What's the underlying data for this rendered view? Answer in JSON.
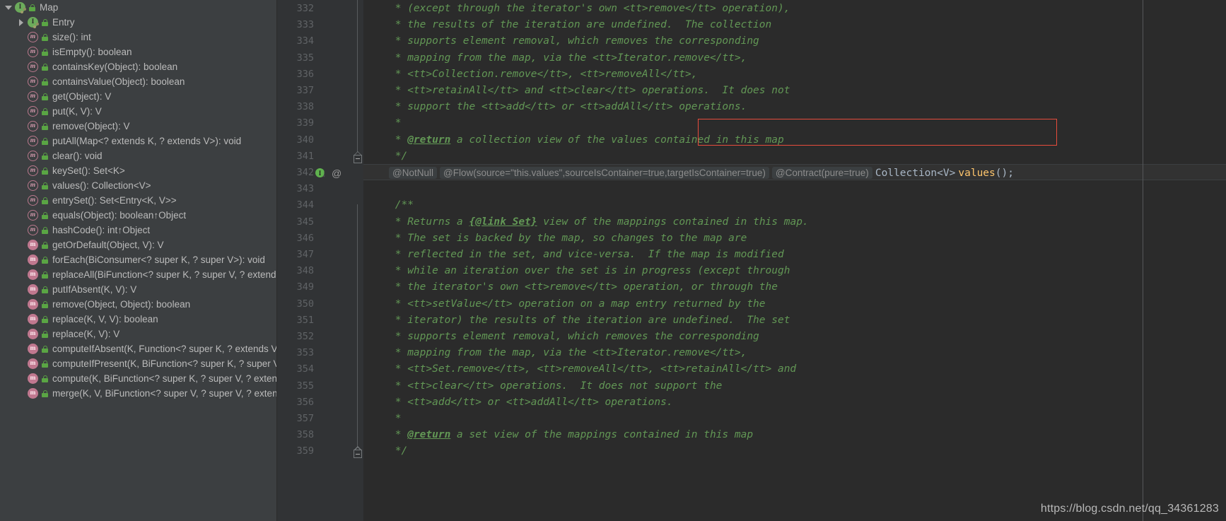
{
  "theme": {
    "panel_bg": "#3c3f41",
    "editor_bg": "#2b2b2b",
    "gutter_bg": "#313335",
    "javadoc_green": "#629755",
    "inlay_grey": "#8c8c8c",
    "method_yellow": "#ffc66d",
    "highlight_red": "#e74c3c",
    "tree_text": "#bbbbbb",
    "line_number": "#606366"
  },
  "structure_panel": {
    "name": "structure-tool-window",
    "items": [
      {
        "label": "Map",
        "indent": 0,
        "twisty": "expanded",
        "icon": "interface-icon",
        "icon_glyph": "I",
        "lock": "public-lock-icon",
        "inherited": ""
      },
      {
        "label": "Entry",
        "indent": 1,
        "twisty": "collapsed",
        "icon": "interface-icon",
        "icon_glyph": "I",
        "lock": "public-lock-icon",
        "inherited": ""
      },
      {
        "label": "size(): int",
        "indent": 1,
        "twisty": "none",
        "icon": "abstract-method-icon",
        "icon_glyph": "m",
        "lock": "public-lock-icon",
        "inherited": ""
      },
      {
        "label": "isEmpty(): boolean",
        "indent": 1,
        "twisty": "none",
        "icon": "abstract-method-icon",
        "icon_glyph": "m",
        "lock": "public-lock-icon",
        "inherited": ""
      },
      {
        "label": "containsKey(Object): boolean",
        "indent": 1,
        "twisty": "none",
        "icon": "abstract-method-icon",
        "icon_glyph": "m",
        "lock": "public-lock-icon",
        "inherited": ""
      },
      {
        "label": "containsValue(Object): boolean",
        "indent": 1,
        "twisty": "none",
        "icon": "abstract-method-icon",
        "icon_glyph": "m",
        "lock": "public-lock-icon",
        "inherited": ""
      },
      {
        "label": "get(Object): V",
        "indent": 1,
        "twisty": "none",
        "icon": "abstract-method-icon",
        "icon_glyph": "m",
        "lock": "public-lock-icon",
        "inherited": ""
      },
      {
        "label": "put(K, V): V",
        "indent": 1,
        "twisty": "none",
        "icon": "abstract-method-icon",
        "icon_glyph": "m",
        "lock": "public-lock-icon",
        "inherited": ""
      },
      {
        "label": "remove(Object): V",
        "indent": 1,
        "twisty": "none",
        "icon": "abstract-method-icon",
        "icon_glyph": "m",
        "lock": "public-lock-icon",
        "inherited": ""
      },
      {
        "label": "putAll(Map<? extends K, ? extends V>): void",
        "indent": 1,
        "twisty": "none",
        "icon": "abstract-method-icon",
        "icon_glyph": "m",
        "lock": "public-lock-icon",
        "inherited": ""
      },
      {
        "label": "clear(): void",
        "indent": 1,
        "twisty": "none",
        "icon": "abstract-method-icon",
        "icon_glyph": "m",
        "lock": "public-lock-icon",
        "inherited": ""
      },
      {
        "label": "keySet(): Set<K>",
        "indent": 1,
        "twisty": "none",
        "icon": "abstract-method-icon",
        "icon_glyph": "m",
        "lock": "public-lock-icon",
        "inherited": ""
      },
      {
        "label": "values(): Collection<V>",
        "indent": 1,
        "twisty": "none",
        "icon": "abstract-method-icon",
        "icon_glyph": "m",
        "lock": "public-lock-icon",
        "inherited": ""
      },
      {
        "label": "entrySet(): Set<Entry<K, V>>",
        "indent": 1,
        "twisty": "none",
        "icon": "abstract-method-icon",
        "icon_glyph": "m",
        "lock": "public-lock-icon",
        "inherited": ""
      },
      {
        "label": "equals(Object): boolean",
        "indent": 1,
        "twisty": "none",
        "icon": "abstract-method-icon",
        "icon_glyph": "m",
        "lock": "public-lock-icon",
        "inherited": "↑Object"
      },
      {
        "label": "hashCode(): int",
        "indent": 1,
        "twisty": "none",
        "icon": "abstract-method-icon",
        "icon_glyph": "m",
        "lock": "public-lock-icon",
        "inherited": "↑Object"
      },
      {
        "label": "getOrDefault(Object, V): V",
        "indent": 1,
        "twisty": "none",
        "icon": "default-method-icon",
        "icon_glyph": "m",
        "lock": "public-lock-icon",
        "inherited": ""
      },
      {
        "label": "forEach(BiConsumer<? super K, ? super V>): void",
        "indent": 1,
        "twisty": "none",
        "icon": "default-method-icon",
        "icon_glyph": "m",
        "lock": "public-lock-icon",
        "inherited": ""
      },
      {
        "label": "replaceAll(BiFunction<? super K, ? super V, ? extends V>): void",
        "indent": 1,
        "twisty": "none",
        "icon": "default-method-icon",
        "icon_glyph": "m",
        "lock": "public-lock-icon",
        "inherited": ""
      },
      {
        "label": "putIfAbsent(K, V): V",
        "indent": 1,
        "twisty": "none",
        "icon": "default-method-icon",
        "icon_glyph": "m",
        "lock": "public-lock-icon",
        "inherited": ""
      },
      {
        "label": "remove(Object, Object): boolean",
        "indent": 1,
        "twisty": "none",
        "icon": "default-method-icon",
        "icon_glyph": "m",
        "lock": "public-lock-icon",
        "inherited": ""
      },
      {
        "label": "replace(K, V, V): boolean",
        "indent": 1,
        "twisty": "none",
        "icon": "default-method-icon",
        "icon_glyph": "m",
        "lock": "public-lock-icon",
        "inherited": ""
      },
      {
        "label": "replace(K, V): V",
        "indent": 1,
        "twisty": "none",
        "icon": "default-method-icon",
        "icon_glyph": "m",
        "lock": "public-lock-icon",
        "inherited": ""
      },
      {
        "label": "computeIfAbsent(K, Function<? super K, ? extends V>): V",
        "indent": 1,
        "twisty": "none",
        "icon": "default-method-icon",
        "icon_glyph": "m",
        "lock": "public-lock-icon",
        "inherited": ""
      },
      {
        "label": "computeIfPresent(K, BiFunction<? super K, ? super V, ? extends V>): V",
        "indent": 1,
        "twisty": "none",
        "icon": "default-method-icon",
        "icon_glyph": "m",
        "lock": "public-lock-icon",
        "inherited": ""
      },
      {
        "label": "compute(K, BiFunction<? super K, ? super V, ? extends V>): V",
        "indent": 1,
        "twisty": "none",
        "icon": "default-method-icon",
        "icon_glyph": "m",
        "lock": "public-lock-icon",
        "inherited": ""
      },
      {
        "label": "merge(K, V, BiFunction<? super V, ? super V, ? extends V>): V",
        "indent": 1,
        "twisty": "none",
        "icon": "default-method-icon",
        "icon_glyph": "m",
        "lock": "public-lock-icon",
        "inherited": ""
      }
    ]
  },
  "editor": {
    "name": "java-source-editor",
    "first_line_number": 332,
    "lines": [
      {
        "num": 332,
        "kind": "javadoc",
        "text": " * (except through the iterator's own <tt>remove</tt> operation),"
      },
      {
        "num": 333,
        "kind": "javadoc",
        "text": " * the results of the iteration are undefined.  The collection"
      },
      {
        "num": 334,
        "kind": "javadoc",
        "text": " * supports element removal, which removes the corresponding"
      },
      {
        "num": 335,
        "kind": "javadoc",
        "text": " * mapping from the map, via the <tt>Iterator.remove</tt>,"
      },
      {
        "num": 336,
        "kind": "javadoc",
        "text": " * <tt>Collection.remove</tt>, <tt>removeAll</tt>,"
      },
      {
        "num": 337,
        "kind": "javadoc",
        "text": " * <tt>retainAll</tt> and <tt>clear</tt> operations.  It does not"
      },
      {
        "num": 338,
        "kind": "javadoc",
        "text": " * support the <tt>add</tt> or <tt>addAll</tt> operations."
      },
      {
        "num": 339,
        "kind": "javadoc",
        "text": " *"
      },
      {
        "num": 340,
        "kind": "javadoc-return",
        "prefix": " * ",
        "tag": "@return",
        "text": " a collection view of the values contained in this map"
      },
      {
        "num": 341,
        "kind": "javadoc",
        "text": " */"
      },
      {
        "num": 342,
        "kind": "signature"
      },
      {
        "num": 343,
        "kind": "blank",
        "text": ""
      },
      {
        "num": 344,
        "kind": "javadoc",
        "text": " /**"
      },
      {
        "num": 345,
        "kind": "javadoc-link",
        "prefix": " * Returns a ",
        "tag": "{@link",
        "mid": " Set}",
        "text": " view of the mappings contained in this map."
      },
      {
        "num": 346,
        "kind": "javadoc",
        "text": " * The set is backed by the map, so changes to the map are"
      },
      {
        "num": 347,
        "kind": "javadoc",
        "text": " * reflected in the set, and vice-versa.  If the map is modified"
      },
      {
        "num": 348,
        "kind": "javadoc",
        "text": " * while an iteration over the set is in progress (except through"
      },
      {
        "num": 349,
        "kind": "javadoc",
        "text": " * the iterator's own <tt>remove</tt> operation, or through the"
      },
      {
        "num": 350,
        "kind": "javadoc",
        "text": " * <tt>setValue</tt> operation on a map entry returned by the"
      },
      {
        "num": 351,
        "kind": "javadoc",
        "text": " * iterator) the results of the iteration are undefined.  The set"
      },
      {
        "num": 352,
        "kind": "javadoc",
        "text": " * supports element removal, which removes the corresponding"
      },
      {
        "num": 353,
        "kind": "javadoc",
        "text": " * mapping from the map, via the <tt>Iterator.remove</tt>,"
      },
      {
        "num": 354,
        "kind": "javadoc",
        "text": " * <tt>Set.remove</tt>, <tt>removeAll</tt>, <tt>retainAll</tt> and"
      },
      {
        "num": 355,
        "kind": "javadoc",
        "text": " * <tt>clear</tt> operations.  It does not support the"
      },
      {
        "num": 356,
        "kind": "javadoc",
        "text": " * <tt>add</tt> or <tt>addAll</tt> operations."
      },
      {
        "num": 357,
        "kind": "javadoc",
        "text": " *"
      },
      {
        "num": 358,
        "kind": "javadoc-return",
        "prefix": " * ",
        "tag": "@return",
        "text": " a set view of the mappings contained in this map"
      },
      {
        "num": 359,
        "kind": "javadoc",
        "text": " */"
      }
    ],
    "signature_line": {
      "num": 342,
      "inlay_hints": [
        "@NotNull",
        "@Flow(source=\"this.values\",sourceIsContainer=true,targetIsContainer=true)",
        "@Contract(pure=true)"
      ],
      "return_type": "Collection<V>",
      "method_name": "values",
      "tail": "();",
      "gutter_icons": [
        "implementing-method-icon",
        "annotation-icon"
      ],
      "implementing_icon_glyph": "I",
      "annotation_icon_glyph": "@"
    },
    "fold_markers": [
      {
        "line": 341,
        "type": "fold-end-cap"
      },
      {
        "line": 359,
        "type": "fold-end-cap"
      }
    ],
    "highlight_box": {
      "name": "red-annotation-box",
      "target_line": 340,
      "color": "#e74c3c"
    }
  },
  "watermark": {
    "text": "https://blog.csdn.net/qq_34361283"
  }
}
